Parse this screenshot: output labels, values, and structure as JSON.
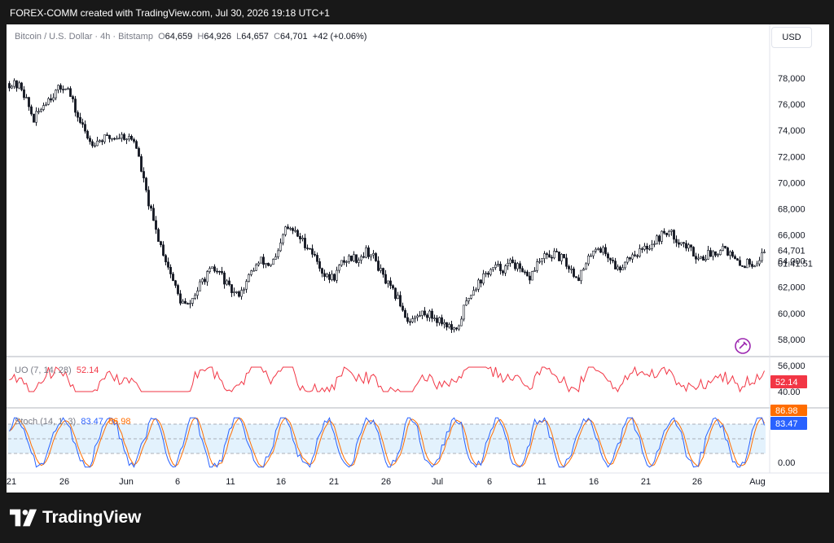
{
  "header": {
    "title": "FOREX-COMM created with TradingView.com, Jul 30, 2026 19:18 UTC+1"
  },
  "toolbar": {
    "currency_label": "USD"
  },
  "legend": {
    "symbol": "Bitcoin / U.S. Dollar · 4h · Bitstamp",
    "open_label": "O",
    "open": "64,659",
    "high_label": "H",
    "high": "64,926",
    "low_label": "L",
    "low": "64,657",
    "close_label": "C",
    "close": "64,701",
    "change": "+42 (+0.06%)"
  },
  "price_tag": {
    "value": "64,701",
    "countdown": "01:41:51"
  },
  "uo": {
    "label": "UO (7, 14, 28)",
    "value": "52.14",
    "tag": "52.14",
    "level_label": "40.00"
  },
  "stoch": {
    "label": "Stoch (14, 1, 3)",
    "k_value": "83.47",
    "d_value": "86.98",
    "k_tag": "83.47",
    "d_tag": "86.98",
    "zero_label": "0.00"
  },
  "colors": {
    "candle": "#131722",
    "uo_line": "#f23645",
    "stoch_k": "#2962ff",
    "stoch_d": "#ff6d00",
    "stoch_band": "#e3f2fd",
    "accent_icon": "#9c27b0"
  },
  "branding": {
    "name": "TradingView"
  },
  "chart_data": [
    {
      "type": "candlestick",
      "title": "Bitcoin / U.S. Dollar · 4h · Bitstamp",
      "x_ticks": [
        "21",
        "26",
        "Jun",
        "6",
        "11",
        "16",
        "21",
        "26",
        "Jul",
        "6",
        "11",
        "16",
        "21",
        "26",
        "Aug"
      ],
      "y_ticks": [
        "78,000",
        "76,000",
        "74,000",
        "72,000",
        "70,000",
        "68,000",
        "66,000",
        "64,000",
        "62,000",
        "60,000",
        "58,000",
        "56,000"
      ],
      "ylim": [
        56000,
        79500
      ],
      "close_path": [
        [
          0,
          77600
        ],
        [
          1.5,
          77300
        ],
        [
          3,
          74800
        ],
        [
          4.5,
          76300
        ],
        [
          6,
          77100
        ],
        [
          7,
          77500
        ],
        [
          8.5,
          74900
        ],
        [
          10,
          73100
        ],
        [
          12,
          73400
        ],
        [
          14,
          73600
        ],
        [
          15.5,
          73200
        ],
        [
          16,
          71700
        ],
        [
          17,
          68800
        ],
        [
          18,
          66400
        ],
        [
          19,
          64600
        ],
        [
          20,
          62800
        ],
        [
          21,
          61000
        ],
        [
          22,
          60500
        ],
        [
          23,
          61600
        ],
        [
          24,
          62700
        ],
        [
          25,
          63300
        ],
        [
          26,
          63100
        ],
        [
          27,
          61900
        ],
        [
          28,
          61400
        ],
        [
          29,
          62100
        ],
        [
          30,
          63400
        ],
        [
          31,
          64000
        ],
        [
          32,
          63700
        ],
        [
          33,
          64300
        ],
        [
          34,
          66500
        ],
        [
          35,
          66300
        ],
        [
          36,
          65600
        ],
        [
          37,
          65000
        ],
        [
          38,
          63900
        ],
        [
          39,
          62700
        ],
        [
          40,
          62800
        ],
        [
          41,
          63900
        ],
        [
          42,
          64300
        ],
        [
          43,
          64200
        ],
        [
          44,
          64800
        ],
        [
          45,
          64200
        ],
        [
          46,
          62800
        ],
        [
          47,
          61800
        ],
        [
          48,
          61000
        ],
        [
          49,
          59500
        ],
        [
          50,
          59600
        ],
        [
          51,
          60100
        ],
        [
          52,
          59800
        ],
        [
          53,
          59500
        ],
        [
          54,
          59100
        ],
        [
          55,
          58400
        ],
        [
          56,
          60400
        ],
        [
          57,
          61800
        ],
        [
          58,
          62500
        ],
        [
          59,
          63200
        ],
        [
          60,
          63500
        ],
        [
          61,
          63400
        ],
        [
          62,
          64000
        ],
        [
          63,
          63100
        ],
        [
          64,
          62600
        ],
        [
          65,
          63800
        ],
        [
          66,
          64300
        ],
        [
          67,
          64500
        ],
        [
          68,
          64200
        ],
        [
          69,
          63500
        ],
        [
          70,
          62700
        ],
        [
          71,
          63600
        ],
        [
          72,
          65100
        ],
        [
          73,
          64900
        ],
        [
          74,
          64200
        ],
        [
          75,
          63300
        ],
        [
          76,
          64200
        ],
        [
          77,
          64600
        ],
        [
          78,
          64800
        ],
        [
          79,
          65300
        ],
        [
          80,
          65800
        ],
        [
          81,
          66300
        ],
        [
          82,
          65800
        ],
        [
          83,
          65300
        ],
        [
          84,
          64800
        ],
        [
          85,
          64200
        ],
        [
          86,
          64500
        ],
        [
          87,
          64700
        ],
        [
          88,
          65200
        ],
        [
          89,
          64300
        ],
        [
          90,
          63600
        ],
        [
          91,
          63900
        ],
        [
          92,
          63900
        ],
        [
          93,
          64701
        ]
      ]
    },
    {
      "type": "line",
      "title": "UO (7, 14, 28)",
      "series": [
        {
          "name": "UO (7, 14, 28)",
          "last": 52.14
        }
      ],
      "y_ticks": [
        "40.00"
      ]
    },
    {
      "type": "line",
      "title": "Stoch (14, 1, 3)",
      "series": [
        {
          "name": "%K",
          "last": 83.47
        },
        {
          "name": "%D",
          "last": 86.98
        }
      ],
      "bands": [
        20,
        50,
        80
      ],
      "y_ticks": [
        "0.00"
      ]
    }
  ]
}
